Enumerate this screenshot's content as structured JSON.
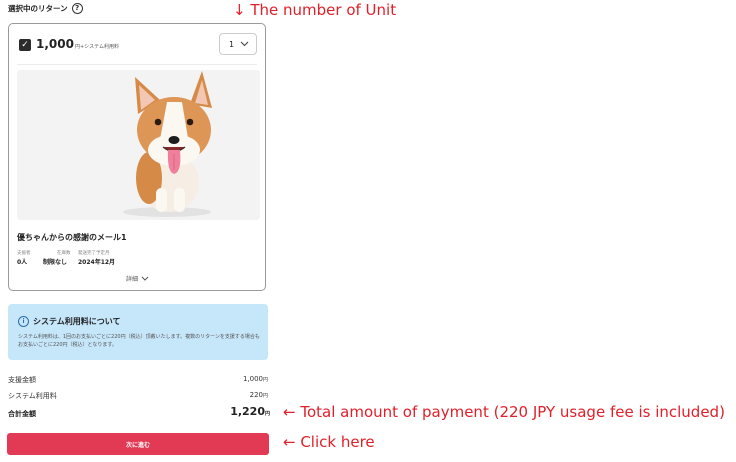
{
  "section": {
    "title": "選択中のリターン",
    "help_icon": "question-circle-icon"
  },
  "reward": {
    "checked": true,
    "price": "1,000",
    "price_suffix": "円+システム利用料",
    "quantity": "1",
    "title": "優ちゃんからの感謝のメール1",
    "meta": [
      {
        "label": "支援者",
        "value": "0人"
      },
      {
        "label": "在庫数",
        "value": "制限なし"
      },
      {
        "label": "発送完了予定月",
        "value": "2024年12月"
      }
    ],
    "details_label": "詳細"
  },
  "notice": {
    "title": "システム利用料について",
    "body": "システム利用料は、1回のお支払いごとに220円（税込）頂戴いたします。複数のリターンを支援する場合もお支払いごとに220円（税込）となります。"
  },
  "summary": {
    "support_label": "支援金額",
    "support_value": "1,000",
    "fee_label": "システム利用料",
    "fee_value": "220",
    "total_label": "合計金額",
    "total_value": "1,220",
    "currency": "円"
  },
  "next_button": "次に進む",
  "annotations": {
    "unit": "↓ The number of Unit",
    "total": "← Total amount of payment (220 JPY usage fee is included)",
    "click": "← Click here"
  },
  "colors": {
    "button": "#e23a55",
    "notice_bg": "#c6e6fa",
    "annotation": "#e0202a"
  }
}
